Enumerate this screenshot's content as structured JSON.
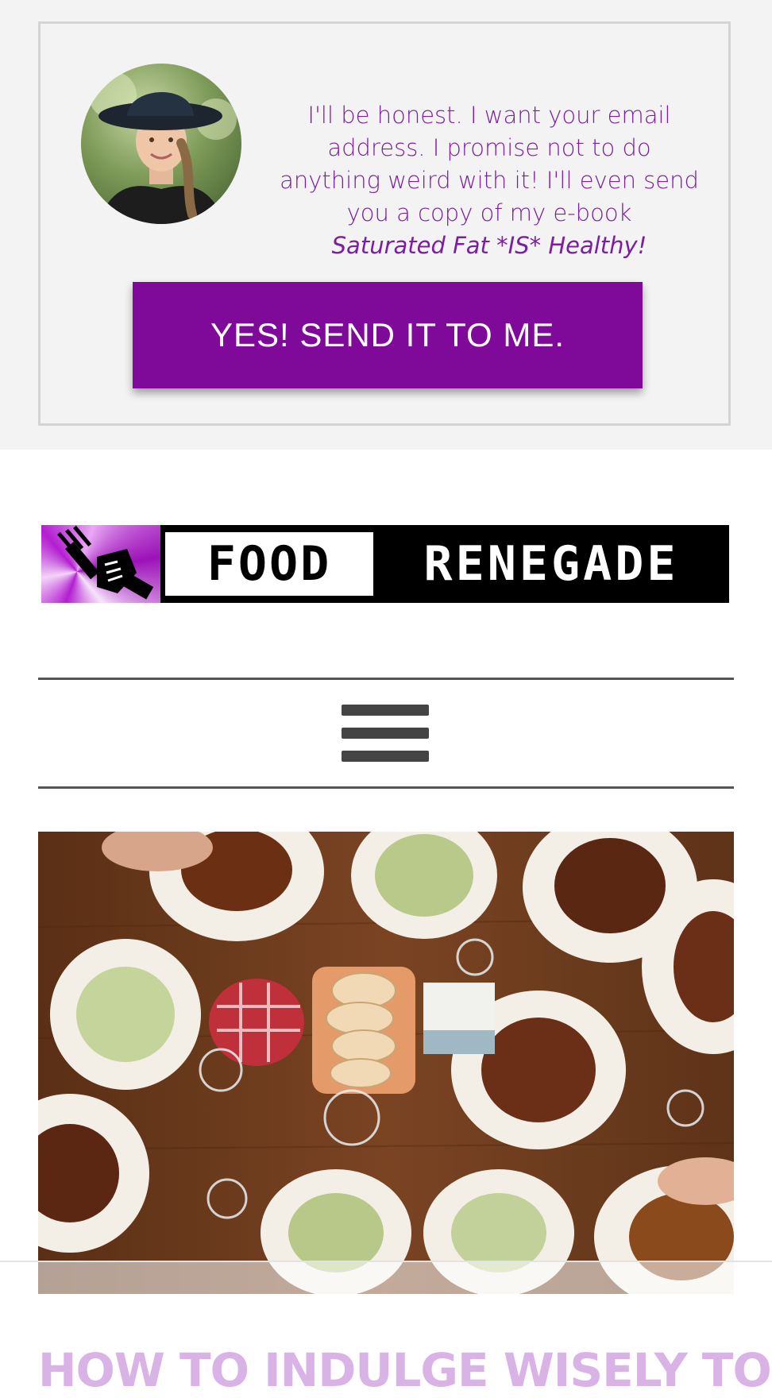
{
  "optin": {
    "pitch_text": "I'll be honest. I want your email address. I promise not to do anything weird with it! I'll even send you a copy of my e-book",
    "book_title": "Saturated Fat *IS* Healthy!",
    "cta_label": "YES! SEND IT TO ME.",
    "colors": {
      "text": "#7b1ea0",
      "button": "#7f0a99",
      "background": "#f3f3f3"
    }
  },
  "logo": {
    "word1": "FOOD",
    "word2": "RENEGADE",
    "brand_color": "#b21ed0"
  },
  "nav": {
    "menu_icon": "hamburger-menu-icon"
  },
  "article": {
    "title": "HOW TO INDULGE WISELY TO"
  }
}
